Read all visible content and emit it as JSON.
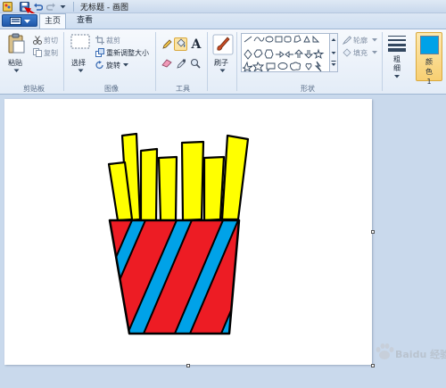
{
  "window": {
    "title": "无标题 - 画图"
  },
  "tabs": {
    "home": "主页",
    "view": "查看"
  },
  "clipboard": {
    "paste": "粘贴",
    "cut": "剪切",
    "copy": "复制",
    "group": "剪贴板"
  },
  "image": {
    "select": "选择",
    "crop": "裁剪",
    "resize": "重新调整大小",
    "rotate": "旋转",
    "group": "图像"
  },
  "tools": {
    "group": "工具"
  },
  "brushes": {
    "label": "刷子"
  },
  "shapes": {
    "outline": "轮廓",
    "fill": "填充",
    "group": "形状"
  },
  "size": {
    "label": "粗细"
  },
  "color1": {
    "label": "颜色 1"
  },
  "watermark": {
    "text": "Baidu 经验"
  },
  "colors": {
    "fries_yellow": "#ffff00",
    "stripe_red": "#ed1c24",
    "stripe_blue": "#00a2e8",
    "outline": "#000000",
    "accent_red": "#d40000"
  }
}
